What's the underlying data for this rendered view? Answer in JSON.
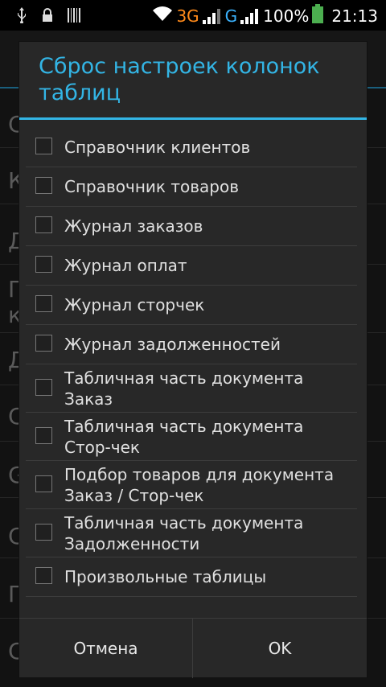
{
  "status_bar": {
    "network_3g": "3G",
    "network_g": "G",
    "battery_percent": "100%",
    "time": "21:13",
    "icons": [
      "usb-icon",
      "lock-icon",
      "barcode-icon",
      "wifi-icon",
      "signal-icon",
      "battery-icon"
    ]
  },
  "background": {
    "items": [
      "С",
      "К",
      "Д",
      "П",
      "к",
      "Д",
      "С",
      "G",
      "С",
      "П",
      "С"
    ]
  },
  "dialog": {
    "title": "Сброс настроек колонок таблиц",
    "items": [
      {
        "label": "Справочник клиентов",
        "checked": false
      },
      {
        "label": "Справочник товаров",
        "checked": false
      },
      {
        "label": "Журнал заказов",
        "checked": false
      },
      {
        "label": "Журнал оплат",
        "checked": false
      },
      {
        "label": "Журнал сторчек",
        "checked": false
      },
      {
        "label": "Журнал задолженностей",
        "checked": false
      },
      {
        "label": "Табличная часть документа Заказ",
        "checked": false
      },
      {
        "label": "Табличная часть документа Стор-чек",
        "checked": false
      },
      {
        "label": "Подбор товаров для документа Заказ / Стор-чек",
        "checked": false
      },
      {
        "label": "Табличная часть документа Задолженности",
        "checked": false
      },
      {
        "label": "Произвольные таблицы",
        "checked": false
      }
    ],
    "cancel_label": "Отмена",
    "ok_label": "OK"
  },
  "colors": {
    "accent": "#33b5e5",
    "net_3g": "#ff8a1a",
    "net_g": "#3bb3ff",
    "battery": "#4caf50"
  }
}
